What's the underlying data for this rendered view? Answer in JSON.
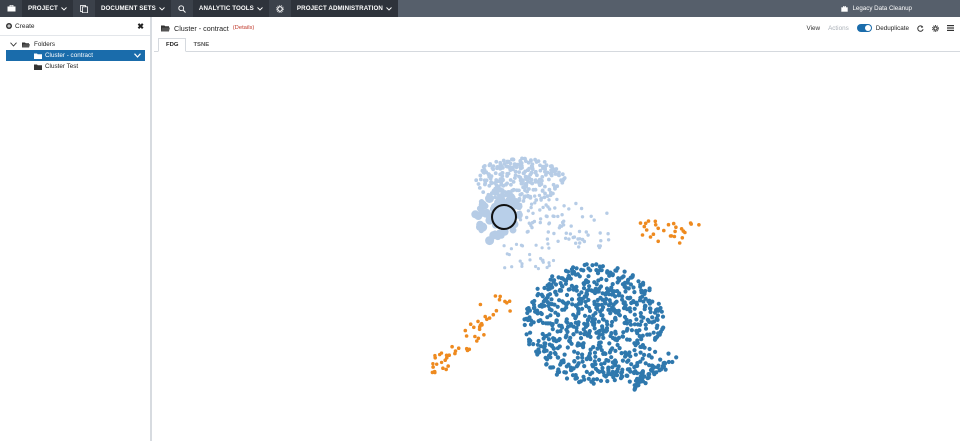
{
  "nav": {
    "items": [
      {
        "label": "PROJECT",
        "icon": "briefcase-icon"
      },
      {
        "label": "DOCUMENT SETS",
        "icon": "documents-icon"
      },
      {
        "label": "ANALYTIC TOOLS",
        "icon": "search-icon"
      },
      {
        "label": "PROJECT ADMINISTRATION",
        "icon": "gear-icon"
      }
    ],
    "project_name": "Legacy Data Cleanup"
  },
  "sidebar": {
    "create_label": "Create",
    "root": {
      "label": "Folders"
    },
    "items": [
      {
        "label": "Cluster - contract",
        "selected": true
      },
      {
        "label": "Cluster Test",
        "selected": false
      }
    ]
  },
  "header": {
    "title": "Cluster - contract",
    "details_label": "(Details)",
    "view_label": "View",
    "actions_label": "Actions",
    "dedupe_label": "Deduplicate",
    "dedupe_on": true
  },
  "tabs": [
    {
      "label": "FDG",
      "active": true
    },
    {
      "label": "TSNE",
      "active": false
    }
  ],
  "colors": {
    "nav_bg": "#565f6b",
    "selection": "#1a6cab",
    "cluster_light": "#b6cce6",
    "cluster_dark": "#2f78ad",
    "cluster_orange": "#ee8a1f"
  }
}
